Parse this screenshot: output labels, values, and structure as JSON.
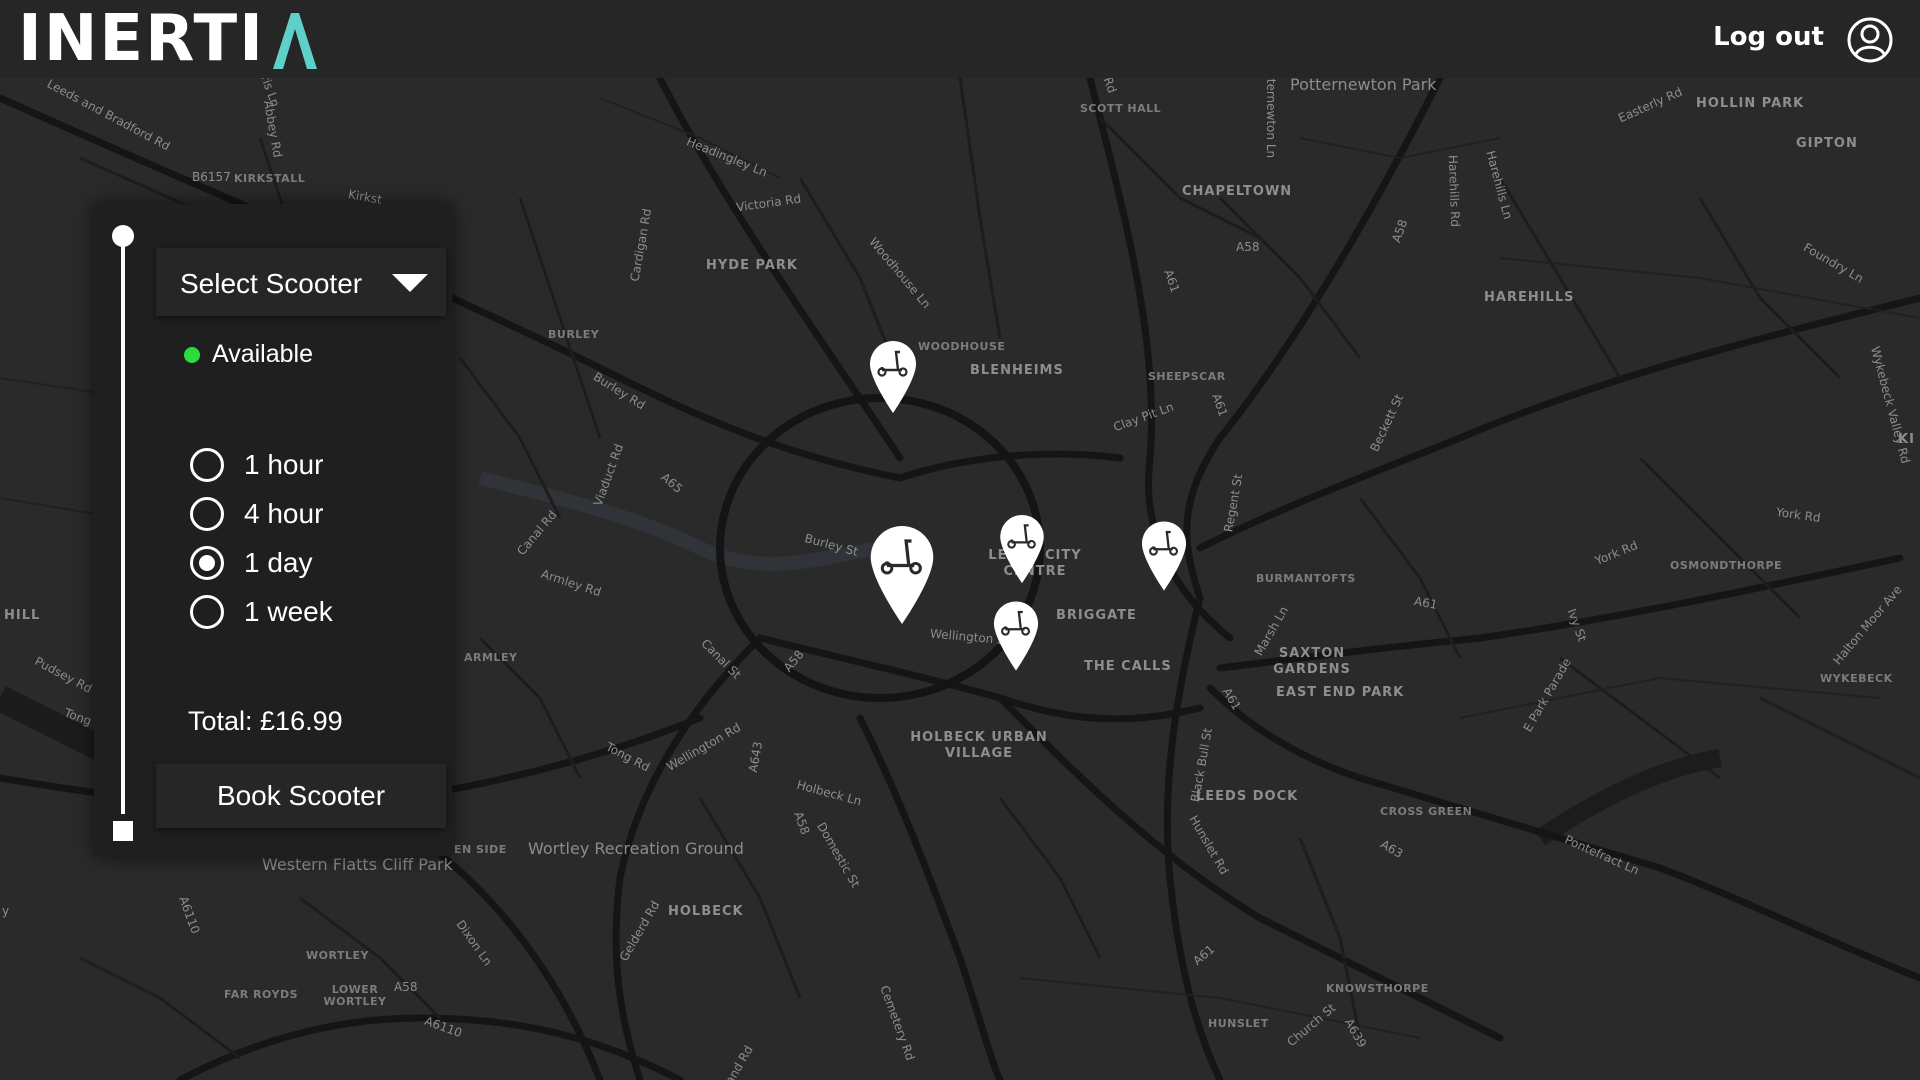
{
  "app": {
    "logo_text": "INERTI",
    "logout_label": "Log out",
    "avatar_icon": "user-circle-icon",
    "accent_color": "#5fd0c8"
  },
  "booking": {
    "select_label": "Select Scooter",
    "select_icon": "chevron-down-icon",
    "status_label": "Available",
    "status_color": "#2ddb3a",
    "durations": [
      {
        "label": "1 hour",
        "selected": false
      },
      {
        "label": "4 hour",
        "selected": false
      },
      {
        "label": "1 day",
        "selected": true
      },
      {
        "label": "1 week",
        "selected": false
      }
    ],
    "total_label": "Total: £16.99",
    "book_label": "Book Scooter"
  },
  "map": {
    "pin_icon": "scooter-pin-icon",
    "pin_count": 5,
    "labels": {
      "hollin_park": "HOLLIN PARK",
      "gipton": "GIPTON",
      "chapeltown": "CHAPELTOWN",
      "harehills": "HAREHILLS",
      "hyde_park": "HYDE PARK",
      "woodhouse": "WOODHOUSE",
      "blenheims": "BLENHEIMS",
      "sheepscar": "SHEEPSCAR",
      "burley": "BURLEY",
      "kirkstall": "KIRKSTALL",
      "scott_hall": "SCOTT HALL",
      "potternewton_park": "Potternewton Park",
      "city_centre": "LEEDS CITY CENTRE",
      "briggate": "BRIGGATE",
      "the_calls": "THE CALLS",
      "burmantofts": "BURMANTOFTS",
      "osmondthorpe": "OSMONDTHORPE",
      "saxton_gardens": "SAXTON GARDENS",
      "east_end_park": "EAST END PARK",
      "wykebeck": "WYKEBECK",
      "armley": "ARMLEY",
      "hill": "HILL",
      "holbeck_urban_village": "HOLBECK URBAN VILLAGE",
      "leeds_dock": "LEEDS DOCK",
      "cross_green": "CROSS GREEN",
      "holbeck": "HOLBECK",
      "wortley": "WORTLEY",
      "far_royds": "FAR ROYDS",
      "lower_wortley": "LOWER WORTLEY",
      "knowsthorpe": "KNOWSTHORPE",
      "hunslet": "HUNSLET",
      "western_flatts": "Western Flatts Cliff Park",
      "wortley_rec": "Wortley Recreation Ground",
      "ki": "KI",
      "en_side": "EN SIDE"
    },
    "roads": {
      "headingley_ln": "Headingley Ln",
      "victoria_rd": "Victoria Rd",
      "woodhouse_ln": "Woodhouse Ln",
      "cardigan_rd": "Cardigan Rd",
      "clay_pit_ln": "Clay Pit Ln",
      "regent_st": "Regent St",
      "a58_north": "A58",
      "a61_north": "A61",
      "york_rd": "York Rd",
      "burley_st": "Burley St",
      "wellington_st": "Wellington St",
      "canal_st": "Canal St",
      "armley_rd": "Armley Rd",
      "a58_west": "A58",
      "tong_rd": "Tong Rd",
      "wellington_rd": "Wellington Rd",
      "a643": "A643",
      "holbeck_ln": "Holbeck Ln",
      "domestic_st": "Domestic St",
      "marsh_ln": "Marsh Ln",
      "black_bull_st": "Black Bull St",
      "hunslet_rd": "Hunslet Rd",
      "pontefract_ln": "Pontefract Ln",
      "leeds_bradford_rd": "Leeds and Bradford Rd",
      "easterly_rd": "Easterly Rd",
      "foundry_ln": "Foundry Ln",
      "a6110": "A6110",
      "dixon_ln": "Dixon Ln",
      "pudsey_rd": "Pudsey Rd",
      "burley_rd": "Burley Rd",
      "viaduct_rd": "Viaduct Rd",
      "canal_rd": "Canal Rd",
      "a65": "A65",
      "beckett_st": "Beckett St",
      "harehills_ln": "Harehills Ln",
      "a63": "A63",
      "a61_south": "A61",
      "church_st": "Church St",
      "a639": "A639",
      "e_park_parade": "E Park Parade",
      "ivy_st": "Ivy St",
      "halton_moor_ave": "Halton Moor Ave",
      "wykebeck_valley_rd": "Wykebeck Valley Rd",
      "cemetery_rd": "Cemetery Rd",
      "gelderd_rd": "Gelderd Rd",
      "b6157": "B6157",
      "abbey_rd": "Abbey Rd",
      "ris_ln": "ris Ln",
      "kirkst": "Kirkst",
      "tong": "Tong",
      "a58_south": "A58",
      "a6110_south": "A6110",
      "a58_ne": "A58",
      "a61_mid": "A61",
      "potternewton_ln": "Potternewton Ln",
      "harehills_rd": "Harehills Rd",
      "a61_se": "A61",
      "a58_sw": "A58",
      "a61_east": "A61",
      "york_rd_east": "York Rd",
      "rd_north": "Rd",
      "rd_south": "and Rd",
      "y_edge": "y"
    }
  }
}
